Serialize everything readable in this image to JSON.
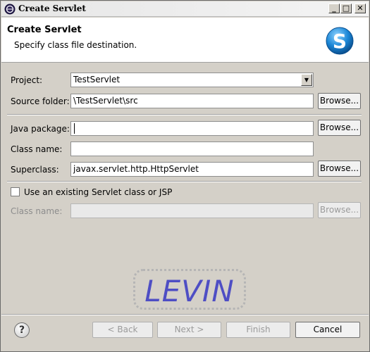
{
  "window": {
    "title": "Create Servlet",
    "minimize": "_",
    "maximize": "□",
    "close": "✕"
  },
  "banner": {
    "heading": "Create Servlet",
    "description": "Specify class file destination.",
    "icon_letter": "S"
  },
  "form": {
    "project_label": "Project:",
    "project_value": "TestServlet",
    "source_folder_label": "Source folder:",
    "source_folder_value": "\\TestServlet\\src",
    "java_package_label": "Java package:",
    "java_package_value": "",
    "class_name_label": "Class name:",
    "class_name_value": "",
    "superclass_label": "Superclass:",
    "superclass_value": "javax.servlet.http.HttpServlet",
    "browse_label": "Browse...",
    "existing_checkbox_label": "Use an existing Servlet class or JSP",
    "existing_checked": false,
    "existing_class_label": "Class name:",
    "existing_class_value": ""
  },
  "watermark": {
    "text": "LEVIN"
  },
  "footer": {
    "help_icon": "?",
    "back_label": "< Back",
    "next_label": "Next >",
    "finish_label": "Finish",
    "cancel_label": "Cancel"
  },
  "colors": {
    "dialog_bg": "#d4d0c8",
    "watermark_text": "#4e4ec4",
    "banner_icon": "#1a86d6"
  }
}
